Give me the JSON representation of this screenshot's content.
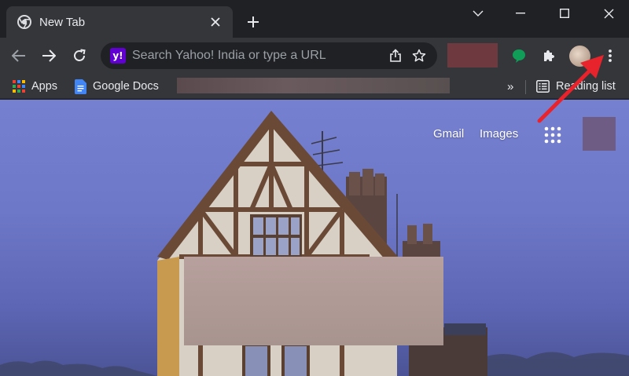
{
  "window": {
    "tab": {
      "title": "New Tab",
      "favicon": "chrome-icon"
    },
    "controls": [
      "chevron-down-icon",
      "minimize-icon",
      "maximize-icon",
      "close-icon"
    ]
  },
  "toolbar": {
    "omnibox": {
      "placeholder": "Search Yahoo! India or type a URL",
      "value": "",
      "search_engine_icon": "y!"
    }
  },
  "bookmarks": {
    "items": [
      {
        "label": "Apps"
      },
      {
        "label": "Google Docs"
      }
    ],
    "overflow": "»",
    "reading_list": "Reading list"
  },
  "ntp": {
    "links": [
      "Gmail",
      "Images"
    ]
  },
  "colors": {
    "frame": "#202124",
    "toolbar": "#35363a",
    "annotation_arrow": "#e8232b",
    "sky": "#7680d0"
  }
}
